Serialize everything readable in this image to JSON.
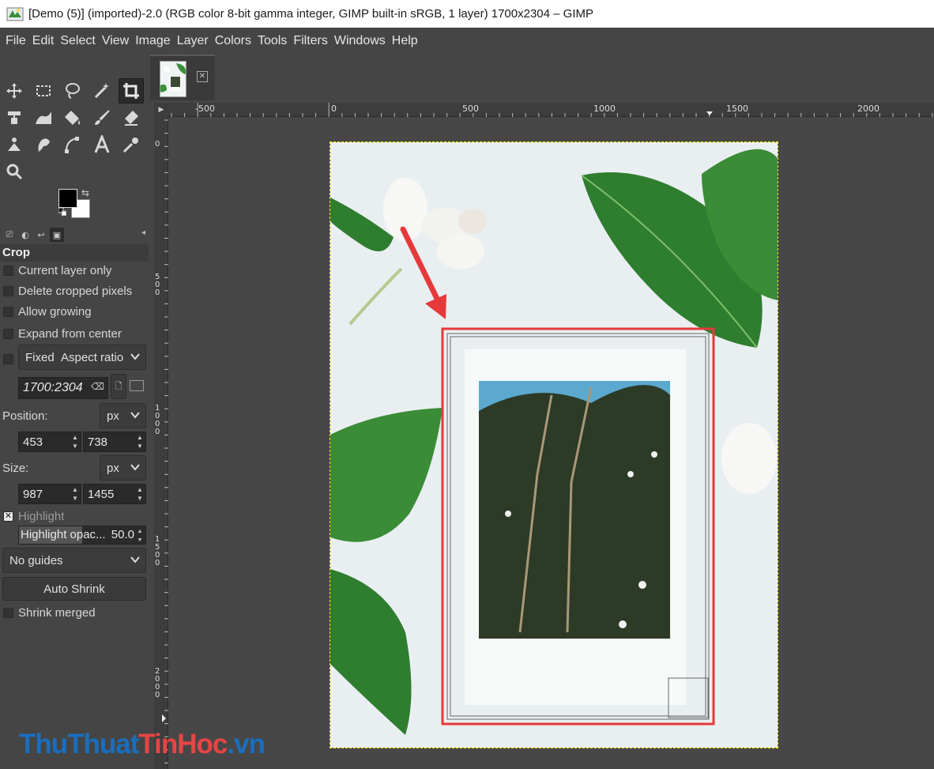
{
  "window": {
    "title": "[Demo (5)] (imported)-2.0 (RGB color 8-bit gamma integer, GIMP built-in sRGB, 1 layer) 1700x2304 – GIMP"
  },
  "menu": [
    "File",
    "Edit",
    "Select",
    "View",
    "Image",
    "Layer",
    "Colors",
    "Tools",
    "Filters",
    "Windows",
    "Help"
  ],
  "tools": [
    "move-tool-icon",
    "rect-select-icon",
    "free-select-icon",
    "fuzzy-select-icon",
    "crop-tool-icon",
    "align-tool-icon",
    "warp-tool-icon",
    "bucket-fill-icon",
    "paintbrush-icon",
    "eraser-icon",
    "clone-tool-icon",
    "smudge-tool-icon",
    "path-tool-icon",
    "text-tool-icon",
    "color-picker-icon",
    "zoom-tool-icon"
  ],
  "colors": {
    "foreground": "#000000",
    "background": "#ffffff",
    "crop_highlight": "#e5393c",
    "selection_dash": "#ffef00"
  },
  "tool_options": {
    "title": "Crop",
    "current_layer_only": "Current layer only",
    "delete_cropped": "Delete cropped pixels",
    "allow_growing": "Allow growing",
    "expand_center": "Expand from center",
    "fixed_label": "Fixed",
    "fixed_mode": "Aspect ratio",
    "ratio_value": "1700:2304",
    "position_label": "Position:",
    "position_unit": "px",
    "position_x": "453",
    "position_y": "738",
    "size_label": "Size:",
    "size_unit": "px",
    "size_w": "987",
    "size_h": "1455",
    "highlight_label": "Highlight",
    "highlight_opacity_label": "Highlight opac...",
    "highlight_opacity_value": "50.0",
    "highlight_opacity_fraction": 0.5,
    "guides": "No guides",
    "auto_shrink": "Auto Shrink",
    "shrink_merged": "Shrink merged"
  },
  "rulers": {
    "h_labels": [
      "-500",
      "0",
      "500",
      "1000",
      "1500",
      "2000"
    ],
    "v_labels": [
      "0",
      "500",
      "1000",
      "1500",
      "2000"
    ]
  },
  "watermark": {
    "part1": "ThuThuat",
    "part2": "TinHoc",
    "part3": ".vn"
  }
}
